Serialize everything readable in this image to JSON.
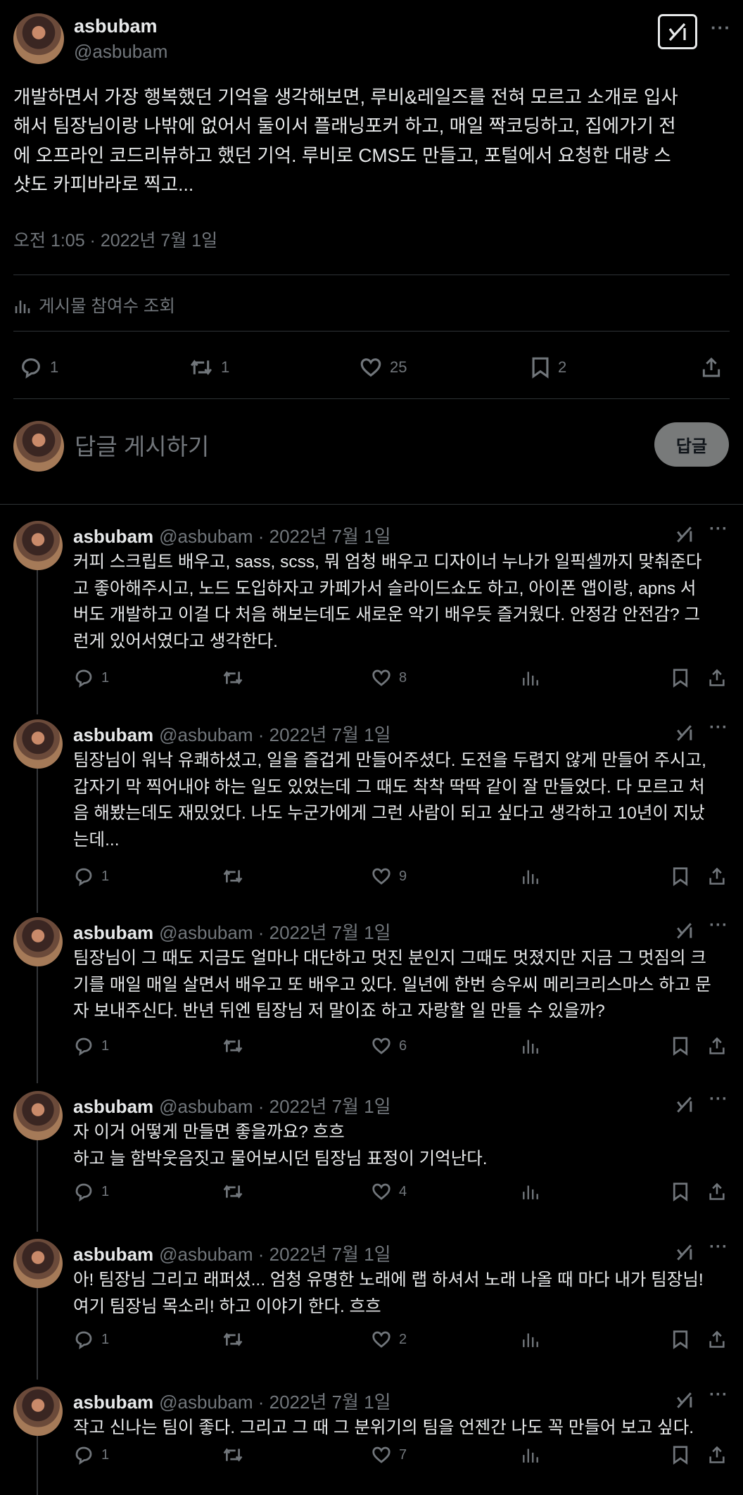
{
  "main_post": {
    "display_name": "asbubam",
    "handle": "@asbubam",
    "text": "개발하면서 가장 행복했던 기억을 생각해보면, 루비&레일즈를 전혀 모르고 소개로 입사\n해서 팀장님이랑 나밖에 없어서 둘이서 플래닝포커 하고, 매일 짝코딩하고, 집에가기 전\n에 오프라인 코드리뷰하고 했던 기억. 루비로 CMS도 만들고, 포털에서 요청한 대량 스\n샷도 카피바라로 찍고...",
    "timestamp": "오전 1:05 · 2022년 7월 1일",
    "engagements_label": "게시물 참여수 조회",
    "stats": {
      "replies": "1",
      "reposts": "1",
      "likes": "25",
      "bookmarks": "2"
    }
  },
  "composer": {
    "placeholder": "답글 게시하기",
    "button_label": "답글"
  },
  "replies": [
    {
      "name": "asbubam",
      "handle": "@asbubam · 2022년 7월 1일",
      "text": "커피 스크립트 배우고, sass, scss, 뭐 엄청 배우고 디자이너 누나가 일픽셀까지 맞춰준다\n고 좋아해주시고, 노드 도입하자고 카페가서 슬라이드쇼도 하고, 아이폰 앱이랑, apns 서\n버도 개발하고 이걸 다 처음 해보는데도 새로운 악기 배우듯 즐거웠다. 안정감 안전감? 그\n런게 있어서였다고 생각한다.",
      "replies": "1",
      "likes": "8"
    },
    {
      "name": "asbubam",
      "handle": "@asbubam · 2022년 7월 1일",
      "text": "팀장님이 워낙 유쾌하셨고, 일을 즐겁게 만들어주셨다. 도전을 두렵지 않게 만들어 주시고,\n갑자기 막 찍어내야 하는 일도 있었는데 그 때도 착착 딱딱 같이 잘 만들었다. 다 모르고 처\n음 해봤는데도 재밌었다. 나도 누군가에게 그런 사람이 되고 싶다고 생각하고 10년이 지났\n는데...",
      "replies": "1",
      "likes": "9"
    },
    {
      "name": "asbubam",
      "handle": "@asbubam · 2022년 7월 1일",
      "text": "팀장님이 그 때도 지금도 얼마나 대단하고 멋진 분인지 그때도 멋졌지만 지금 그 멋짐의 크\n기를 매일 매일 살면서 배우고 또 배우고 있다. 일년에 한번 승우씨 메리크리스마스 하고 문\n자 보내주신다. 반년 뒤엔 팀장님 저 말이죠 하고 자랑할 일 만들 수 있을까?",
      "replies": "1",
      "likes": "6"
    },
    {
      "name": "asbubam",
      "handle": "@asbubam · 2022년 7월 1일",
      "text": "자 이거 어떻게 만들면 좋을까요? 흐흐\n하고 늘 함박웃음짓고 물어보시던 팀장님 표정이 기억난다.",
      "replies": "1",
      "likes": "4"
    },
    {
      "name": "asbubam",
      "handle": "@asbubam · 2022년 7월 1일",
      "text": "아! 팀장님 그리고 래퍼셨... 엄청 유명한 노래에 랩 하셔서 노래 나올 때 마다 내가 팀장님!\n여기 팀장님 목소리! 하고 이야기 한다. 흐흐",
      "replies": "1",
      "likes": "2"
    },
    {
      "name": "asbubam",
      "handle": "@asbubam · 2022년 7월 1일",
      "text": "작고 신나는 팀이 좋다. 그리고 그 때 그 분위기의 팀을 언젠간 나도 꼭 만들어 보고 싶다.",
      "replies": "1",
      "likes": "7"
    }
  ],
  "icons": {
    "grok": "grok-icon",
    "more": "more-icon",
    "reply": "reply-icon",
    "repost": "repost-icon",
    "like": "heart-icon",
    "views": "views-icon",
    "bookmark": "bookmark-icon",
    "share": "share-icon"
  },
  "colors": {
    "background": "#000000",
    "text": "#e7e9ea",
    "muted": "#71767b",
    "divider": "#2f3336",
    "reply_button_bg": "#787a7a"
  }
}
